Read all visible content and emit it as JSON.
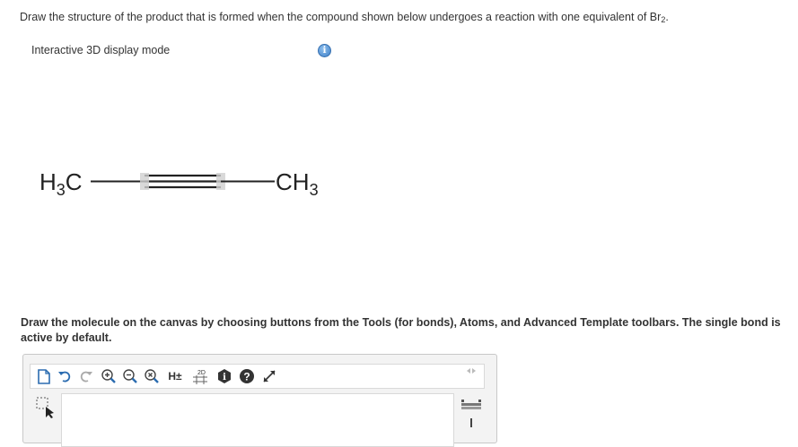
{
  "question": {
    "prefix": "Draw the structure of the product that is formed when the compound shown below undergoes a reaction with one equivalent of Br",
    "subscript": "2",
    "suffix": "."
  },
  "display_mode": {
    "label": "Interactive 3D display mode",
    "info_glyph": "i"
  },
  "molecule": {
    "left_group": {
      "main": "H",
      "sub": "3",
      "tail": "C"
    },
    "right_group": {
      "main": "CH",
      "sub": "3"
    },
    "bond": "triple"
  },
  "instructions": "Draw the molecule on the canvas by choosing buttons from the Tools (for bonds), Atoms, and Advanced Template toolbars. The single bond is active by default.",
  "toolbar": {
    "icons": [
      "new-document-icon",
      "undo-icon",
      "redo-icon",
      "zoom-in-icon",
      "zoom-out-icon",
      "clear-icon",
      "hydrogen-toggle-icon",
      "clean-2d-icon",
      "info-icon",
      "help-icon",
      "fullscreen-icon"
    ],
    "hydrogen_label": "H±",
    "clean_label": "2D",
    "help_glyph": "?",
    "info_glyph": "i"
  },
  "colors": {
    "info_blue": "#3d7fc8",
    "text": "#333333",
    "bond": "#222222"
  }
}
